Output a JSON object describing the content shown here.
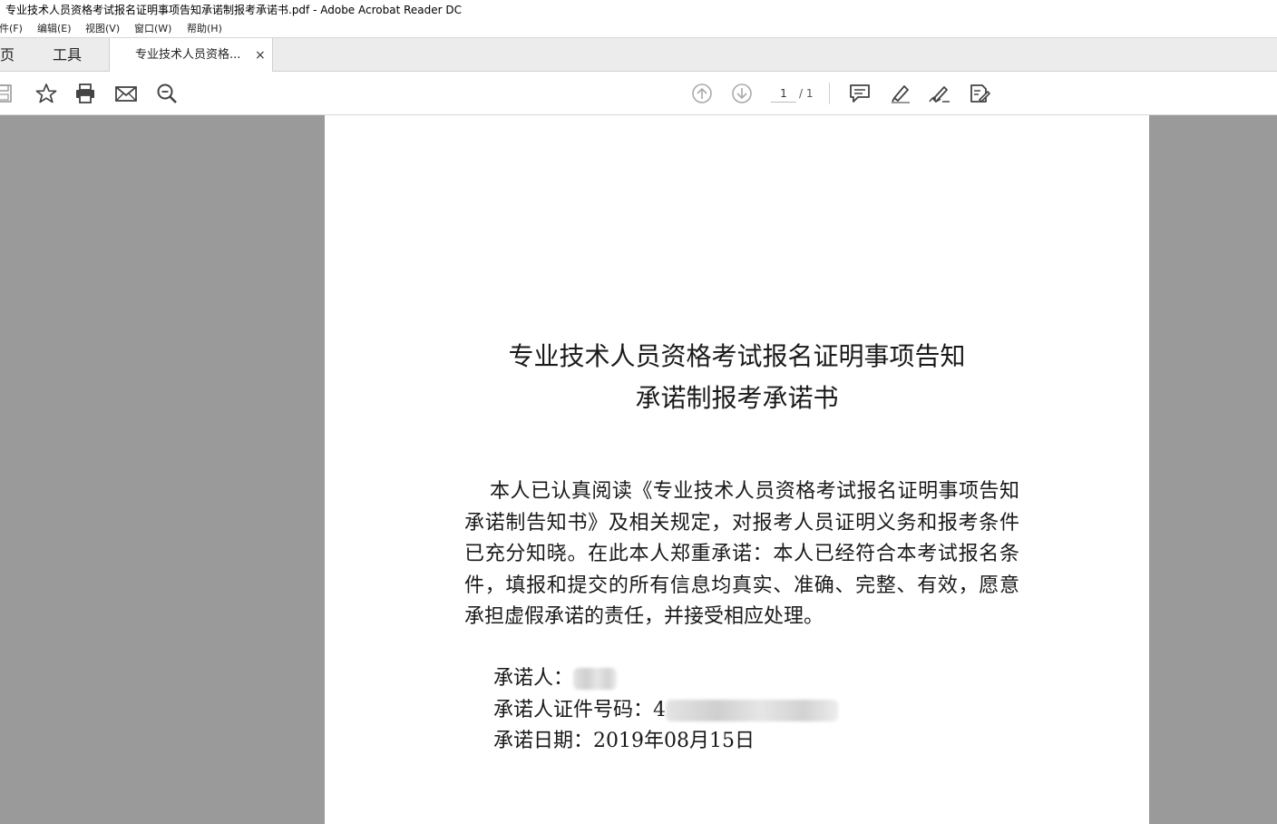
{
  "window": {
    "title": "专业技术人员资格考试报名证明事项告知承诺制报考承诺书.pdf - Adobe Acrobat Reader DC"
  },
  "menu": {
    "items": [
      "文件(F)",
      "编辑(E)",
      "视图(V)",
      "窗口(W)",
      "帮助(H)"
    ]
  },
  "tabs": {
    "home": "主页",
    "tools": "工具",
    "document": "专业技术人员资格...",
    "close_glyph": "×"
  },
  "toolbar": {
    "icons": [
      "save-icon",
      "bookmark-star-icon",
      "print-icon",
      "email-icon",
      "zoom-search-icon",
      "page-up-icon",
      "page-down-icon",
      "comment-icon",
      "highlight-pen-icon",
      "sign-icon",
      "fill-edit-icon"
    ],
    "current_page": "1",
    "total_pages": "/ 1"
  },
  "document": {
    "title_line1": "专业技术人员资格考试报名证明事项告知",
    "title_line2": "承诺制报考承诺书",
    "body": "本人已认真阅读《专业技术人员资格考试报名证明事项告知承诺制告知书》及相关规定，对报考人员证明义务和报考条件已充分知晓。在此本人郑重承诺：本人已经符合本考试报名条件，填报和提交的所有信息均真实、准确、完整、有效，愿意承担虚假承诺的责任，并接受相应处理。",
    "signer_label": "承诺人：",
    "signer_value": "",
    "id_label": "承诺人证件号码：",
    "id_value_prefix": "4",
    "date_label": "承诺日期：",
    "date_value": "2019年08月15日"
  },
  "colors": {
    "viewport_bg": "#9a9a9a",
    "tabbar_bg": "#ececec",
    "page_bg": "#ffffff"
  }
}
